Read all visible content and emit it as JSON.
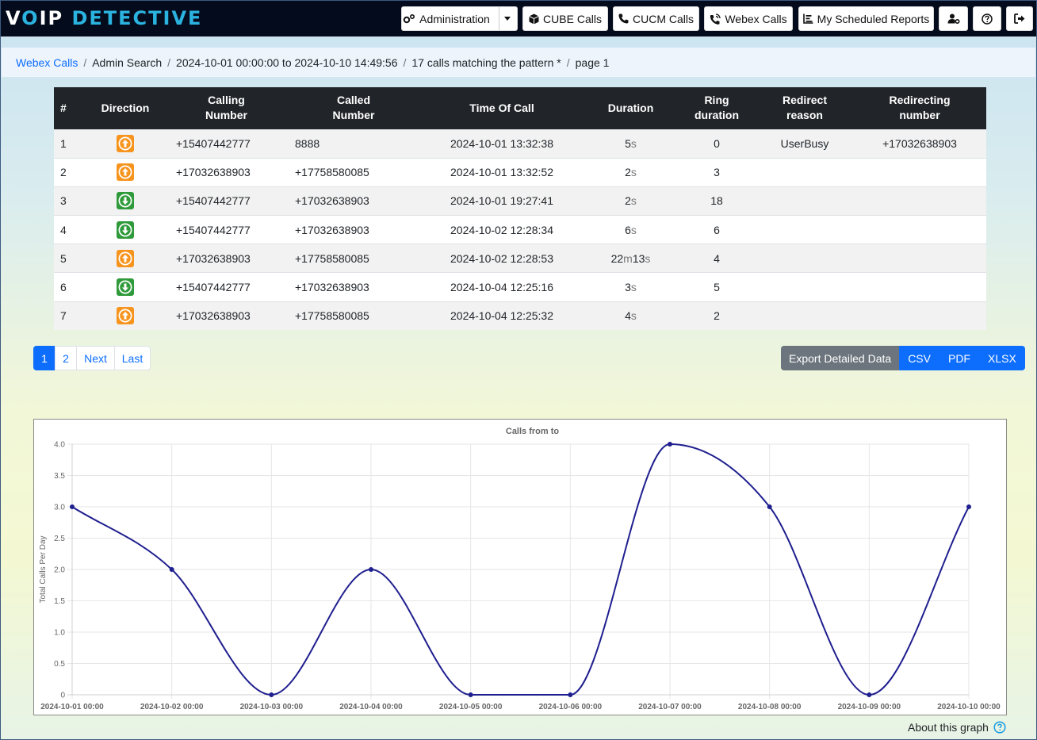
{
  "app": {
    "logo_prefix": "V",
    "logo_o": "O",
    "logo_rest": "IP",
    "logo_detective": "DETECTIVE"
  },
  "nav": {
    "administration": "Administration",
    "cube_calls": "CUBE Calls",
    "cucm_calls": "CUCM Calls",
    "webex_calls": "Webex Calls",
    "scheduled_reports": "My Scheduled Reports"
  },
  "breadcrumb": {
    "items": [
      "Webex Calls",
      "Admin Search",
      "2024-10-01 00:00:00 to 2024-10-10 14:49:56",
      "17 calls matching the pattern *",
      "page 1"
    ]
  },
  "table": {
    "headers": [
      "#",
      "Direction",
      "Calling Number",
      "Called Number",
      "Time Of Call",
      "Duration",
      "Ring duration",
      "Redirect reason",
      "Redirecting number"
    ],
    "rows": [
      {
        "num": "1",
        "direction": "outgoing",
        "calling": "+15407442777",
        "called": "8888",
        "time": "2024-10-01 13:32:38",
        "dur_m": "",
        "dur_s": "5",
        "ring": "0",
        "reason": "UserBusy",
        "redirecting": "+17032638903"
      },
      {
        "num": "2",
        "direction": "outgoing",
        "calling": "+17032638903",
        "called": "+17758580085",
        "time": "2024-10-01 13:32:52",
        "dur_m": "",
        "dur_s": "2",
        "ring": "3",
        "reason": "",
        "redirecting": ""
      },
      {
        "num": "3",
        "direction": "incoming",
        "calling": "+15407442777",
        "called": "+17032638903",
        "time": "2024-10-01 19:27:41",
        "dur_m": "",
        "dur_s": "2",
        "ring": "18",
        "reason": "",
        "redirecting": ""
      },
      {
        "num": "4",
        "direction": "incoming",
        "calling": "+15407442777",
        "called": "+17032638903",
        "time": "2024-10-02 12:28:34",
        "dur_m": "",
        "dur_s": "6",
        "ring": "6",
        "reason": "",
        "redirecting": ""
      },
      {
        "num": "5",
        "direction": "outgoing",
        "calling": "+17032638903",
        "called": "+17758580085",
        "time": "2024-10-02 12:28:53",
        "dur_m": "22",
        "dur_s": "13",
        "ring": "4",
        "reason": "",
        "redirecting": ""
      },
      {
        "num": "6",
        "direction": "incoming",
        "calling": "+15407442777",
        "called": "+17032638903",
        "time": "2024-10-04 12:25:16",
        "dur_m": "",
        "dur_s": "3",
        "ring": "5",
        "reason": "",
        "redirecting": ""
      },
      {
        "num": "7",
        "direction": "outgoing",
        "calling": "+17032638903",
        "called": "+17758580085",
        "time": "2024-10-04 12:25:32",
        "dur_m": "",
        "dur_s": "4",
        "ring": "2",
        "reason": "",
        "redirecting": ""
      }
    ],
    "unit_m": "m",
    "unit_s": "s"
  },
  "pagination": {
    "pages": [
      "1",
      "2"
    ],
    "next": "Next",
    "last": "Last",
    "active": "1"
  },
  "export": {
    "label": "Export Detailed Data",
    "csv": "CSV",
    "pdf": "PDF",
    "xlsx": "XLSX"
  },
  "about_graph": "About this graph",
  "colors": {
    "accent": "#0d6efd",
    "outgoing": "#f7941d",
    "incoming": "#2e9a3a",
    "line": "#1f1f8f",
    "navbar": "#040b1c"
  },
  "chart_data": {
    "type": "line",
    "title": "Calls from  to",
    "ylabel": "Total Calls Per Day",
    "xlabel": "",
    "x": [
      "2024-10-01 00:00",
      "2024-10-02 00:00",
      "2024-10-03 00:00",
      "2024-10-04 00:00",
      "2024-10-05 00:00",
      "2024-10-06 00:00",
      "2024-10-07 00:00",
      "2024-10-08 00:00",
      "2024-10-09 00:00",
      "2024-10-10 00:00"
    ],
    "values": [
      3,
      2,
      0,
      2,
      0,
      0,
      4,
      3,
      0,
      3
    ],
    "yticks": [
      "0",
      "0.5",
      "1.0",
      "1.5",
      "2.0",
      "2.5",
      "3.0",
      "3.5",
      "4.0"
    ],
    "ylim": [
      0,
      4
    ],
    "grid": true
  }
}
